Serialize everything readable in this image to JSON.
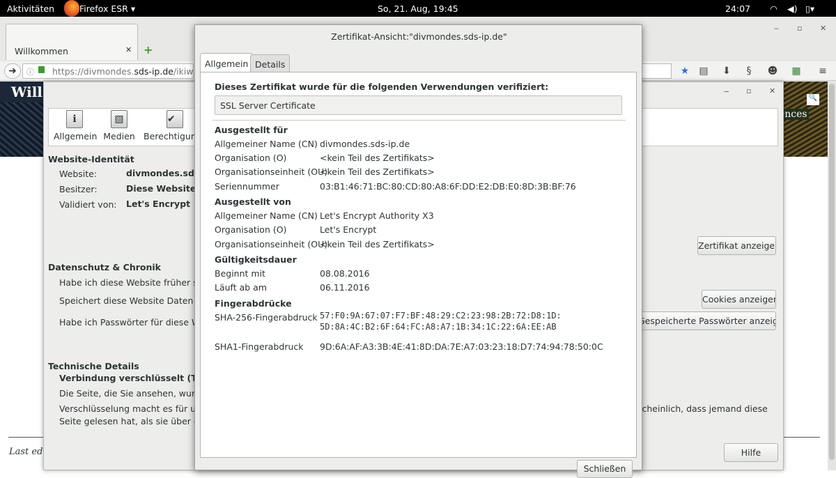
{
  "topbar": {
    "activities": "Aktivitäten",
    "app_menu": "Firefox ESR",
    "clock": "So, 21. Aug, 19:45",
    "time_right": "24:07"
  },
  "firefox": {
    "tab_title": "Willkommen",
    "url_prefix": "https://divmondes.",
    "url_host": "sds-ip.de",
    "url_path": "/ikiwiki/"
  },
  "webpage": {
    "banner_text": "Will",
    "banner_right_text": "ences",
    "last_edited": "Last ed"
  },
  "pageinfo": {
    "tools": [
      {
        "label": "Allgemein",
        "icon": "info-icon"
      },
      {
        "label": "Medien",
        "icon": "media-icon"
      },
      {
        "label": "Berechtigungen",
        "icon": "permissions-icon"
      }
    ],
    "identity_heading": "Website-Identität",
    "website_label": "Website:",
    "website_value": "divmondes.sds-ip",
    "owner_label": "Besitzer:",
    "owner_value": "Diese Website st",
    "verified_label": "Validiert von:",
    "verified_value": "Let's Encrypt",
    "view_cert_button": "Zertifikat anzeigen",
    "privacy_heading": "Datenschutz & Chronik",
    "visited_question": "Habe ich diese Website früher sch",
    "stores_question": "Speichert diese Website Daten (C",
    "cookies_button": "Cookies anzeigen",
    "passwords_question": "Habe ich Passwörter für diese We",
    "passwords_button": "Gespeicherte Passwörter anzeigen",
    "tech_heading": "Technische Details",
    "connection": "Verbindung verschlüsselt (TLS_E",
    "page_view": "Die Seite, die Sie ansehen, wurde",
    "encryption_line1": "Verschlüsselung macht es für unb",
    "encryption_line1_end": "scheinlich, dass jemand diese",
    "encryption_line2": "Seite gelesen hat, als sie über das",
    "help_button": "Hilfe"
  },
  "certificate": {
    "title": "Zertifikat-Ansicht:\"divmondes.sds-ip.de\"",
    "tabs": [
      "Allgemein",
      "Details"
    ],
    "verified_heading": "Dieses Zertifikat wurde für die folgenden Verwendungen verifiziert:",
    "usage": "SSL Server Certificate",
    "issued_to_heading": "Ausgestellt für",
    "issued_to": [
      {
        "label": "Allgemeiner Name (CN)",
        "value": "divmondes.sds-ip.de"
      },
      {
        "label": "Organisation (O)",
        "value": "<kein Teil des Zertifikats>"
      },
      {
        "label": "Organisationseinheit (OU)",
        "value": "<kein Teil des Zertifikats>"
      },
      {
        "label": "Seriennummer",
        "value": "03:B1:46:71:BC:80:CD:80:A8:6F:DD:E2:DB:E0:8D:3B:BF:76"
      }
    ],
    "issued_by_heading": "Ausgestellt von",
    "issued_by": [
      {
        "label": "Allgemeiner Name (CN)",
        "value": "Let's Encrypt Authority X3"
      },
      {
        "label": "Organisation (O)",
        "value": "Let's Encrypt"
      },
      {
        "label": "Organisationseinheit (OU)",
        "value": "<kein Teil des Zertifikats>"
      }
    ],
    "validity_heading": "Gültigkeitsdauer",
    "validity": [
      {
        "label": "Beginnt mit",
        "value": "08.08.2016"
      },
      {
        "label": "Läuft ab am",
        "value": "06.11.2016"
      }
    ],
    "fingerprints_heading": "Fingerabdrücke",
    "sha256_label": "SHA-256-Fingerabdruck",
    "sha256_line1": "57:F0:9A:67:07:F7:BF:48:29:C2:23:98:2B:72:D8:1D:",
    "sha256_line2": "5D:8A:4C:B2:6F:64:FC:A8:A7:1B:34:1C:22:6A:EE:AB",
    "sha1_label": "SHA1-Fingerabdruck",
    "sha1_value": "9D:6A:AF:A3:3B:4E:41:8D:DA:7E:A7:03:23:18:D7:74:94:78:50:0C",
    "close_button": "Schließen"
  }
}
